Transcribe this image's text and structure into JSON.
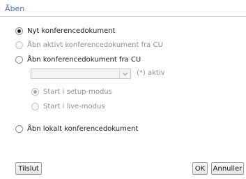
{
  "dialog": {
    "title": "Åben"
  },
  "options": {
    "new_doc": {
      "label": "Nyt konferencedokument",
      "checked": true,
      "disabled": false
    },
    "open_active": {
      "label": "Åbn aktivt konferencedokument fra CU",
      "checked": false,
      "disabled": true
    },
    "open_from_cu": {
      "label": "Åbn konferencedokument fra CU",
      "checked": false,
      "disabled": false
    },
    "open_local": {
      "label": "Åbn lokalt konferencedokument",
      "checked": false,
      "disabled": false
    }
  },
  "document_select": {
    "value": "",
    "suffix": "(*) aktiv"
  },
  "start_mode": {
    "setup": {
      "label": "Start i setup-modus",
      "checked": true,
      "disabled": true
    },
    "live": {
      "label": "Start i live-modus",
      "checked": false,
      "disabled": true
    }
  },
  "buttons": {
    "connect": "Tilslut",
    "ok": "OK",
    "cancel": "Annuller"
  },
  "colors": {
    "title": "#4a76b6",
    "disabled_text": "#8e8e8e"
  },
  "icons": {
    "dropdown": "chevron-down-icon"
  }
}
